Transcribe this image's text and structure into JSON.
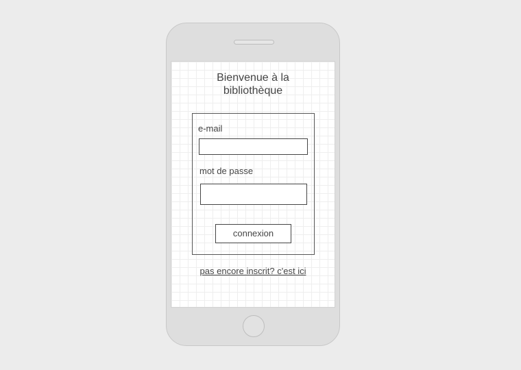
{
  "login": {
    "title_line1": "Bienvenue à la",
    "title_line2": "bibliothèque",
    "email_label": "e-mail",
    "email_value": "",
    "password_label": "mot de passe",
    "password_value": "",
    "submit_label": "connexion",
    "signup_link": "pas encore inscrit? c'est ici"
  },
  "colors": {
    "background": "#ececec",
    "device_body": "#dedede",
    "screen": "#ffffff",
    "grid": "#eeeeee",
    "border": "#444444"
  }
}
